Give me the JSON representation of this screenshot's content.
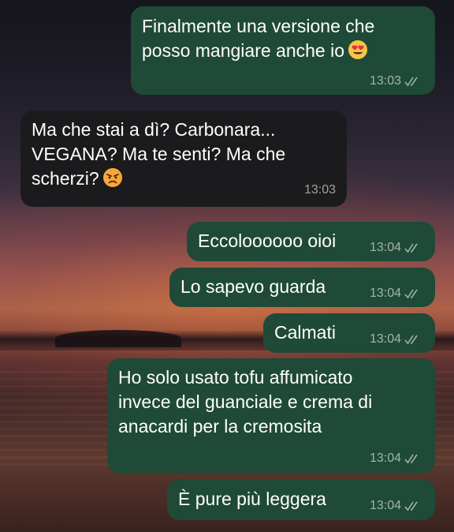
{
  "chat": {
    "messages": [
      {
        "direction": "out",
        "lines": [
          "Finalmente una versione che",
          "posso mangiare anche io"
        ],
        "emoji": "heart-eyes-emoji",
        "time": "13:03",
        "status": "read"
      },
      {
        "direction": "in",
        "lines": [
          "Ma che stai a dì? Carbonara...",
          "VEGANA? Ma te senti? Ma che",
          "scherzi?"
        ],
        "emoji": "angry-face-emoji",
        "time": "13:03"
      },
      {
        "direction": "out",
        "lines": [
          "Eccoloooooo oioi"
        ],
        "time": "13:04",
        "status": "read"
      },
      {
        "direction": "out",
        "lines": [
          "Lo sapevo guarda"
        ],
        "time": "13:04",
        "status": "read"
      },
      {
        "direction": "out",
        "lines": [
          "Calmati"
        ],
        "time": "13:04",
        "status": "read"
      },
      {
        "direction": "out",
        "lines": [
          "Ho solo usato tofu affumicato",
          "invece del guanciale e crema di",
          "anacardi per la cremosita"
        ],
        "time": "13:04",
        "status": "read"
      },
      {
        "direction": "out",
        "lines": [
          "È pure più leggera"
        ],
        "time": "13:04",
        "status": "read"
      }
    ]
  },
  "colors": {
    "outgoing_bubble": "#1f4a37",
    "incoming_bubble": "#1b1b1d",
    "meta_text": "rgba(255,255,255,0.58)"
  }
}
